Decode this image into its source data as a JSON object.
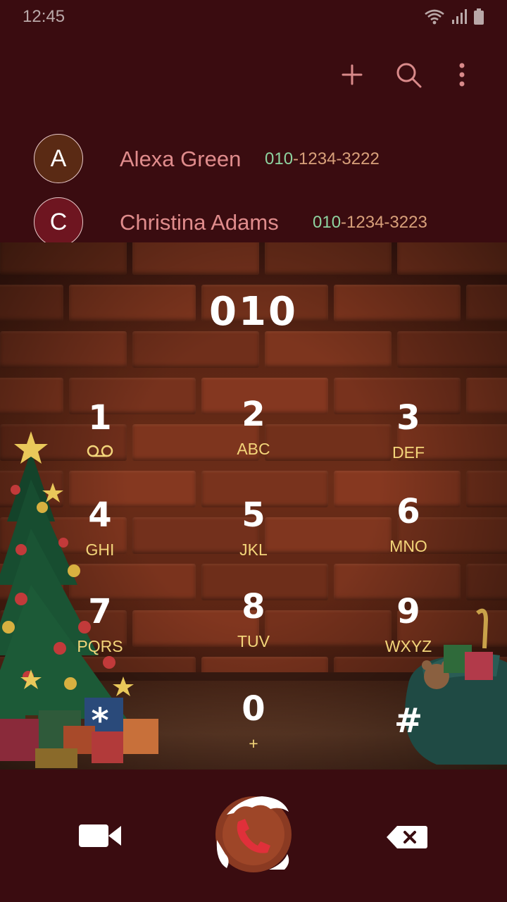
{
  "status": {
    "time": "12:45"
  },
  "contacts": [
    {
      "initial": "A",
      "avatar_color": "#5a2a14",
      "name": "Alexa Green",
      "number_match": "010",
      "number_rest": "-1234-3222"
    },
    {
      "initial": "C",
      "avatar_color": "#6e1520",
      "name": "Christina Adams",
      "number_match": "010",
      "number_rest": "-1234-3223"
    }
  ],
  "dialer": {
    "entered_number": "010",
    "keys": [
      {
        "digit": "1",
        "letters": ""
      },
      {
        "digit": "2",
        "letters": "ABC"
      },
      {
        "digit": "3",
        "letters": "DEF"
      },
      {
        "digit": "4",
        "letters": "GHI"
      },
      {
        "digit": "5",
        "letters": "JKL"
      },
      {
        "digit": "6",
        "letters": "MNO"
      },
      {
        "digit": "7",
        "letters": "PQRS"
      },
      {
        "digit": "8",
        "letters": "TUV"
      },
      {
        "digit": "9",
        "letters": "WXYZ"
      },
      {
        "digit": "*",
        "letters": ""
      },
      {
        "digit": "0",
        "letters": "+"
      },
      {
        "digit": "#",
        "letters": ""
      }
    ]
  },
  "icons": {
    "add": "plus-icon",
    "search": "search-icon",
    "more": "more-vertical-icon",
    "voicemail": "voicemail-icon",
    "video_call": "video-camera-icon",
    "call": "phone-icon",
    "backspace": "backspace-icon"
  },
  "colors": {
    "background": "#3a0c10",
    "accent": "#e08c8c",
    "match_highlight": "#8ed3a0",
    "key_letters": "#f3d57a"
  }
}
